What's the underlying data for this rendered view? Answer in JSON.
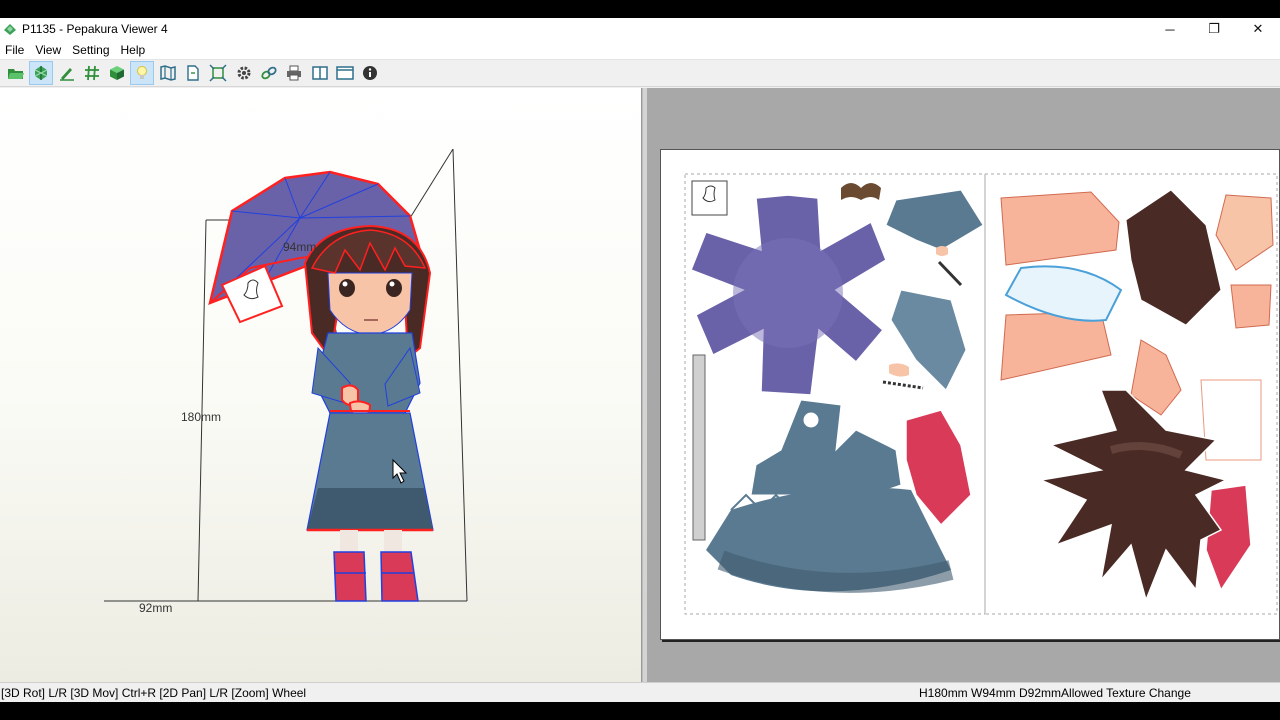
{
  "window": {
    "title": "P1135 - Pepakura Viewer 4",
    "controls": {
      "minimize": "─",
      "restore": "❐",
      "close": "✕"
    }
  },
  "menu": {
    "items": [
      "File",
      "View",
      "Setting",
      "Help"
    ]
  },
  "toolbar": {
    "buttons": [
      "open-folder-icon",
      "unfold-icon",
      "edit-pen-icon",
      "grid-icon",
      "3d-cube-icon",
      "lightbulb-icon",
      "map-icon",
      "page-icon",
      "fit-view-icon",
      "gear-icon",
      "link-icon",
      "printer-icon",
      "split-view-icon",
      "window-icon",
      "info-icon"
    ],
    "active": [
      "unfold-icon",
      "lightbulb-icon"
    ]
  },
  "view3d": {
    "dimensions": {
      "width": "94mm",
      "height": "180mm",
      "depth": "92mm"
    }
  },
  "colors": {
    "edge_red": "#ff2020",
    "edge_blue": "#2040e0",
    "dress": "#5a7a92",
    "umbrella": "#6a62a8",
    "hair": "#4a2a24",
    "boots": "#d83a58",
    "skin": "#f8c4a8"
  },
  "status": {
    "hint": "[3D Rot] L/R [3D Mov] Ctrl+R [2D Pan] L/R [Zoom] Wheel",
    "info": "H180mm W94mm D92mmAllowed Texture Change"
  }
}
